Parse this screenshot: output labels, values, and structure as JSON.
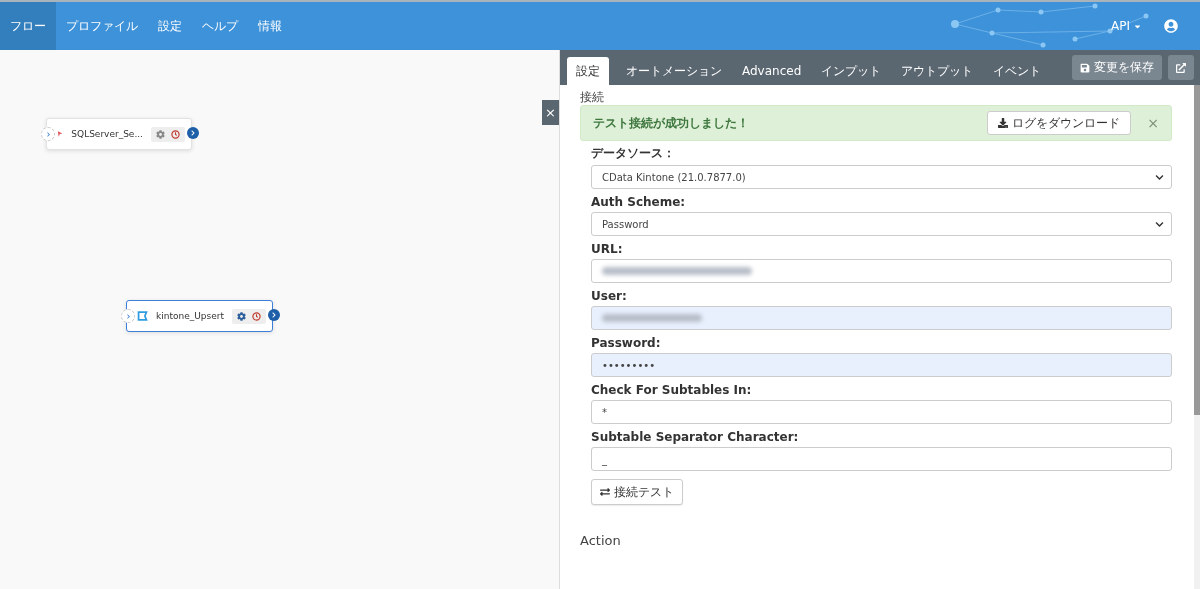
{
  "navbar": {
    "items": [
      {
        "label": "フロー",
        "selected": true
      },
      {
        "label": "プロファイル",
        "selected": false
      },
      {
        "label": "設定",
        "selected": false
      },
      {
        "label": "ヘルプ",
        "selected": false
      },
      {
        "label": "情報",
        "selected": false
      }
    ],
    "api_menu": "API"
  },
  "canvas": {
    "nodes": [
      {
        "name": "SQLServer_Se...",
        "kind": "sqlserver",
        "selected": false
      },
      {
        "name": "kintone_Upsert",
        "kind": "kintone",
        "selected": true
      }
    ],
    "close_button": "×"
  },
  "panel": {
    "tabs": [
      {
        "label": "設定",
        "selected": true
      },
      {
        "label": "オートメーション",
        "selected": false
      },
      {
        "label": "Advanced",
        "selected": false
      },
      {
        "label": "インプット",
        "selected": false
      },
      {
        "label": "アウトプット",
        "selected": false
      },
      {
        "label": "イベント",
        "selected": false
      }
    ],
    "save_button": "変更を保存",
    "section_title": "接続",
    "alert": {
      "message": "テスト接続が成功しました！",
      "download_button": "ログをダウンロード",
      "close": "×"
    },
    "fields": [
      {
        "label": "データソース：",
        "kind": "select",
        "value": "CData Kintone (21.0.7877.0)",
        "autofilled": false
      },
      {
        "label": "Auth Scheme:",
        "kind": "select",
        "value": "Password",
        "autofilled": false
      },
      {
        "label": "URL:",
        "kind": "redacted",
        "autofilled": false
      },
      {
        "label": "User:",
        "kind": "redacted",
        "autofilled": true
      },
      {
        "label": "Password:",
        "kind": "text",
        "value": "•••••••••",
        "autofilled": true
      },
      {
        "label": "Check For Subtables In:",
        "kind": "text",
        "value": "*",
        "autofilled": false
      },
      {
        "label": "Subtable Separator Character:",
        "kind": "text",
        "value": "_",
        "autofilled": false
      }
    ],
    "test_button": "接続テスト",
    "action_title": "Action"
  }
}
